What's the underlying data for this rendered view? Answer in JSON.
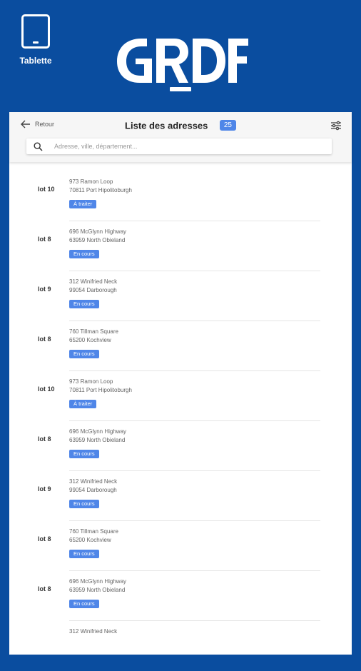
{
  "device": {
    "label": "Tablette",
    "icon": "tablet-icon"
  },
  "brand": {
    "logo_text": "GRDF",
    "color": "#0a4d9f"
  },
  "header": {
    "back_label": "Retour",
    "title": "Liste des adresses",
    "count": "25"
  },
  "search": {
    "placeholder": "Adresse, ville, département..."
  },
  "accent_color": "#4f86e8",
  "rows": [
    {
      "lot": "lot 10",
      "street": "973 Ramon Loop",
      "city": "70811 Port Hipolitoburgh",
      "status": "À traiter"
    },
    {
      "lot": "lot 8",
      "street": "696 McGlynn Highway",
      "city": "63959 North Obieland",
      "status": "En cours"
    },
    {
      "lot": "lot 9",
      "street": "312 Winifried Neck",
      "city": "99054 Darborough",
      "status": "En cours"
    },
    {
      "lot": "lot 8",
      "street": "760 Tillman Square",
      "city": "65200 Kochview",
      "status": "En cours"
    },
    {
      "lot": "lot 10",
      "street": "973 Ramon Loop",
      "city": "70811 Port Hipolitoburgh",
      "status": "À traiter"
    },
    {
      "lot": "lot 8",
      "street": "696 McGlynn Highway",
      "city": "63959 North Obieland",
      "status": "En cours"
    },
    {
      "lot": "lot 9",
      "street": "312 Winifried Neck",
      "city": "99054 Darborough",
      "status": "En cours"
    },
    {
      "lot": "lot 8",
      "street": "760 Tillman Square",
      "city": "65200 Kochview",
      "status": "En cours"
    },
    {
      "lot": "lot 8",
      "street": "696 McGlynn Highway",
      "city": "63959 North Obieland",
      "status": "En cours"
    },
    {
      "lot": "",
      "street": "312 Winifried Neck",
      "city": "",
      "status": ""
    }
  ]
}
